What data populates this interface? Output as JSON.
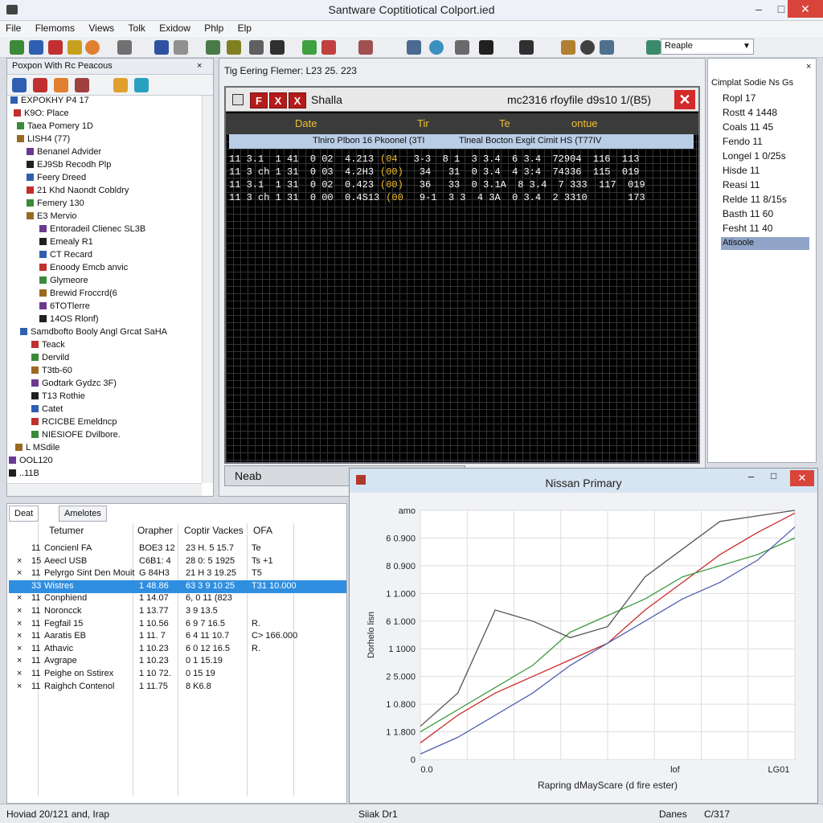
{
  "window": {
    "title": "Santware Coptitiotical Colport.ied",
    "minimize": "–",
    "maximize": "□",
    "close": "✕"
  },
  "menu": [
    "File",
    "Flemoms",
    "Views",
    "Tolk",
    "Exidow",
    "Phlp",
    "Elp"
  ],
  "toolbar": {
    "select_value": "Reaple"
  },
  "tree": {
    "header": "Poxpon With Rc Peacous",
    "items": [
      {
        "label": "EXPOKHY P4 17"
      },
      {
        "label": "K9O: Place"
      },
      {
        "label": "Taea Pomery 1D"
      },
      {
        "label": "LISH4 (77)"
      },
      {
        "label": "Benanel Advider"
      },
      {
        "label": "EJ9Sb Recodh Plp"
      },
      {
        "label": "Feery Dreed"
      },
      {
        "label": "21 Khd Naondt Cobldry"
      },
      {
        "label": "Femery 130"
      },
      {
        "label": "E3 Mervio"
      },
      {
        "label": "Entoradeil Clienec SL3B"
      },
      {
        "label": "Emealy R1"
      },
      {
        "label": "CT Recard"
      },
      {
        "label": "Enoody Emcb anvic"
      },
      {
        "label": "Glymeore"
      },
      {
        "label": "Brewid Froccrd(6"
      },
      {
        "label": "6TOTlerre"
      },
      {
        "label": "14OS Rlonf)"
      },
      {
        "label": "Samdbofto Booly Angl Grcat SaHA"
      },
      {
        "label": "Teack"
      },
      {
        "label": "Dervild"
      },
      {
        "label": "T3tb-60"
      },
      {
        "label": "Godtark Gydzc 3F)"
      },
      {
        "label": "T13 Rothie"
      },
      {
        "label": "Catet"
      },
      {
        "label": "RCICBE Emeldncp"
      },
      {
        "label": "NIESIOFE Dvilbore."
      },
      {
        "label": "L MSdile"
      },
      {
        "label": "OOL120"
      },
      {
        "label": "..11B"
      }
    ]
  },
  "log": {
    "caption": "Tig Eering Flemer: L23 25. 223",
    "terminal_title": "Shalla",
    "terminal_tags": [
      "F",
      "X",
      "X"
    ],
    "terminal_info": "mc2316  rfoyfile d9s10 1/(B5)",
    "columns": [
      "Date",
      "Tir",
      "Te",
      "ontue"
    ],
    "subheader_left": "Tlniro Plbon 16 Pkoonel (3TI",
    "subheader_right": "Tlneal Bocton Exgit Cimit HS (T77IV",
    "rows": [
      {
        "a": "11 3.1  1 41  0 02  4.213",
        "b": "(04",
        "c": "3-3  8 1  3 3.4  6 3.4  72904  116  113"
      },
      {
        "a": "11 3 ch 1 31  0 03  4.2H3",
        "b": "(00)",
        "c": "34   31  0 3.4  4 3:4  74336  115  019"
      },
      {
        "a": "11 3.1  1 31  0 02  0.423",
        "b": "(00)",
        "c": "36   33  0 3.1A  8 3.4  7 333  117  019"
      },
      {
        "a": "11 3 ch 1 31  0 00  0.4S13",
        "b": "(00",
        "c": "9-1  3 3  4 3A  0 3.4  2 3310       173"
      }
    ],
    "status": "Neab"
  },
  "props": {
    "items": [
      "Ropl 17",
      "Rostt 4 1448",
      "Coals 11 45",
      "Fendo 11",
      "Longel 1 0/25s",
      "Hisde 11",
      "Reasi 11",
      "Relde 11 8/15s",
      "Basth 11 60",
      "Fesht 11 40"
    ],
    "selected": "Atisoole",
    "header": "Cimplat Sodie Ns Gs"
  },
  "bottom": {
    "tabs": [
      "Deat",
      "Amelotes"
    ],
    "headers": [
      "Tetumer",
      "Orapher",
      "Coptir Vackes",
      "OFA"
    ],
    "rows": [
      {
        "mark": "",
        "n": "11",
        "name": "Concienl FA",
        "c1": "BOE3 12",
        "c2": "23  H.  5  15.7",
        "c3": "Te"
      },
      {
        "mark": "×",
        "n": "15",
        "name": "Aeecl USB",
        "c1": "C6B1: 4",
        "c2": "28  0:  5  1925",
        "c3": "Ts +1"
      },
      {
        "mark": "×",
        "n": "11",
        "name": "Pelyrgo Sint Den Mouit",
        "c1": "G 84H3",
        "c2": "21  H  3  19.25",
        "c3": "T5"
      },
      {
        "mark": "",
        "n": "33",
        "name": "Wistres",
        "c1": "1  48.86",
        "c2": "63  3  9  10 25",
        "c3": "T31 10.000",
        "selected": true
      },
      {
        "mark": "×",
        "n": "11",
        "name": "Conphiend",
        "c1": "1  14.07",
        "c2": "6, 0  11 (823",
        "c3": ""
      },
      {
        "mark": "×",
        "n": "11",
        "name": "Noroncck",
        "c1": "1  13.77",
        "c2": "3  9  13.5",
        "c3": ""
      },
      {
        "mark": "×",
        "n": "11",
        "name": "Fegfail 15",
        "c1": "1  10.56",
        "c2": "6  9  7  16.5",
        "c3": "R."
      },
      {
        "mark": "×",
        "n": "11",
        "name": "Aaratis EB",
        "c1": "1  11. 7",
        "c2": "6  4  11  10.7",
        "c3": "C> 166.000"
      },
      {
        "mark": "×",
        "n": "11",
        "name": "Athavic",
        "c1": "1  10.23",
        "c2": "6  0  12  16.5",
        "c3": "R."
      },
      {
        "mark": "×",
        "n": "11",
        "name": "Avgrape",
        "c1": "1  10.23",
        "c2": "0   1  15.19",
        "c3": ""
      },
      {
        "mark": "×",
        "n": "11",
        "name": "Peighe on Sstirex",
        "c1": "1  10 72.",
        "c2": "0   15 19",
        "c3": ""
      },
      {
        "mark": "×",
        "n": "11",
        "name": "Raighch Contenol",
        "c1": "1  11.75",
        "c2": "8   K6.8",
        "c3": ""
      }
    ]
  },
  "chart_window": {
    "title": "Nissan Primary"
  },
  "chart_data": {
    "type": "line",
    "title": "",
    "xlabel": "Rapring dMayScare (d fire ester)",
    "ylabel": "Dorhelo lisn",
    "x_ticks": [
      "0.0",
      "lof",
      "LG01"
    ],
    "y_ticks": [
      "amo",
      "6 0.900",
      "8 0.900",
      "1 1.000",
      "6 1.000",
      "1 1000",
      "2 5.000",
      "1 0.800",
      "1 1.800",
      "0"
    ],
    "ylim": [
      0,
      9
    ],
    "x": [
      0,
      1,
      2,
      3,
      4,
      5,
      6,
      7,
      8,
      9,
      10
    ],
    "series": [
      {
        "color": "#cc2a2a",
        "values": [
          0.6,
          1.6,
          2.4,
          3.0,
          3.6,
          4.2,
          5.4,
          6.4,
          7.4,
          8.2,
          8.9
        ]
      },
      {
        "color": "#3d9a3d",
        "values": [
          1.0,
          1.8,
          2.6,
          3.4,
          4.6,
          5.2,
          5.8,
          6.6,
          7.0,
          7.4,
          8.0
        ]
      },
      {
        "color": "#5060b0",
        "values": [
          0.2,
          0.8,
          1.6,
          2.4,
          3.4,
          4.2,
          5.0,
          5.8,
          6.4,
          7.2,
          8.4
        ]
      },
      {
        "color": "#555555",
        "values": [
          1.2,
          2.4,
          5.4,
          5.0,
          4.4,
          4.8,
          6.6,
          7.6,
          8.6,
          8.8,
          9.0
        ]
      }
    ]
  },
  "status": {
    "left": "Hoviad 20/121 and, Irap",
    "mid": "Siiak Dr1",
    "right1": "Danes",
    "right2": "C/317"
  }
}
